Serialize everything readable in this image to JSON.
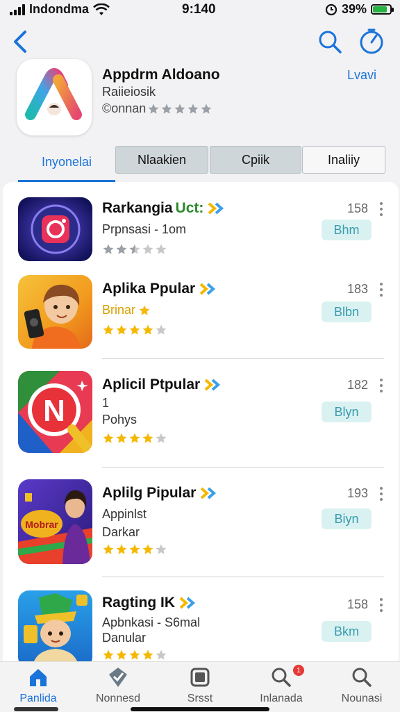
{
  "status_bar": {
    "carrier": "Indondma",
    "time": "9:140",
    "battery": "39%",
    "battery_level": 0.85
  },
  "nav": {
    "back_icon": "chevron-left-icon",
    "search_icon": "search-icon",
    "timer_icon": "timer-icon"
  },
  "app_header": {
    "title": "Appdrm Aldoano",
    "subtitle": "Raiieiosik",
    "rating_text": "©onnan",
    "rating_stars": 3,
    "link": "Lvavi"
  },
  "tabs": [
    {
      "label": "Inyonelai",
      "active": true
    },
    {
      "label": "Nlaakien",
      "active": false
    },
    {
      "label": "Cpiik",
      "active": false
    },
    {
      "label": "Inaliiy",
      "active": false
    }
  ],
  "apps": [
    {
      "title": "Rarkangia",
      "title_suffix": "Uct:",
      "line2": "Prpnsasi - 1om",
      "line3": "",
      "rating": 2.5,
      "count": "158",
      "button": "Bhm",
      "icon": "camera-app-icon"
    },
    {
      "title": "Aplika Ppular",
      "title_suffix": "",
      "line2": "Brinar",
      "line3": "",
      "rating": 4,
      "count": "183",
      "button": "Blbn",
      "icon": "boy-phone-app-icon"
    },
    {
      "title": "Aplicil Ptpular",
      "title_suffix": "",
      "line2": "1",
      "line3": "Pohys",
      "rating": 4,
      "count": "182",
      "button": "Blyn",
      "icon": "n-logo-app-icon"
    },
    {
      "title": "Aplilg Pipular",
      "title_suffix": "",
      "line2": "Appinlst",
      "line3": "Darkar",
      "rating": 4,
      "count": "193",
      "button": "Biyn",
      "icon": "game-app-icon"
    },
    {
      "title": "Ragting IK",
      "title_suffix": "",
      "line2": "Apbnkasi - S6mal",
      "line3": "Danular",
      "rating": 4,
      "count": "158",
      "button": "Bkm",
      "icon": "character-app-icon"
    }
  ],
  "tab_bar": [
    {
      "label": "Panlida",
      "icon": "home-icon",
      "active": true
    },
    {
      "label": "Nonnesd",
      "icon": "badge-icon",
      "active": false
    },
    {
      "label": "Srsst",
      "icon": "apps-icon",
      "active": false
    },
    {
      "label": "Inlanada",
      "icon": "search-icon",
      "active": false,
      "badge": "1"
    },
    {
      "label": "Nounasi",
      "icon": "search-icon",
      "active": false
    }
  ],
  "colors": {
    "accent": "#1a73d9",
    "star": "#f5b800",
    "button_bg": "#d9f2f1",
    "button_text": "#3a9bb0"
  }
}
